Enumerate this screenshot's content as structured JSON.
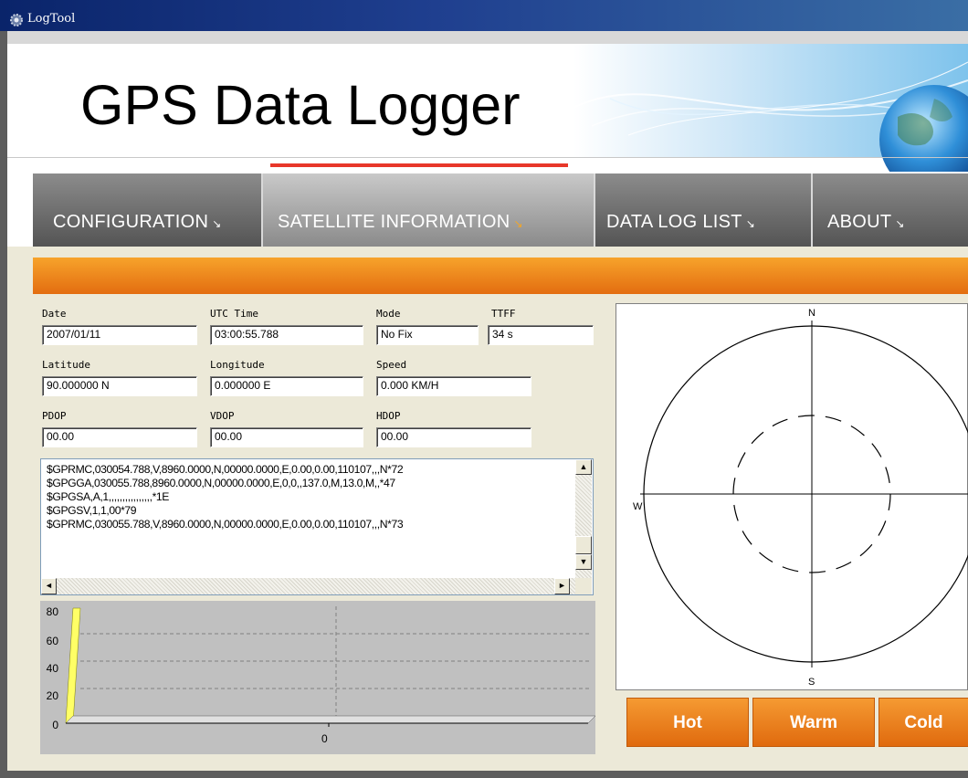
{
  "window": {
    "title": "LogTool"
  },
  "banner": {
    "title": "GPS Data Logger"
  },
  "tabs": [
    {
      "label": "CONFIGURATION",
      "arrow": "↘"
    },
    {
      "label": "SATELLITE  INFORMATION",
      "arrow": "↘"
    },
    {
      "label": "DATA LOG LIST",
      "arrow": "↘"
    },
    {
      "label": "ABOUT",
      "arrow": "↘"
    }
  ],
  "active_tab": "SATELLITE  INFORMATION",
  "fields": {
    "date": {
      "label": "Date",
      "value": "2007/01/11"
    },
    "utc_time": {
      "label": "UTC Time",
      "value": "03:00:55.788"
    },
    "mode": {
      "label": "Mode",
      "value": "No Fix"
    },
    "ttff": {
      "label": "TTFF",
      "value": "34 s"
    },
    "latitude": {
      "label": "Latitude",
      "value": "90.000000 N"
    },
    "longitude": {
      "label": "Longitude",
      "value": "0.000000 E"
    },
    "speed": {
      "label": "Speed",
      "value": "0.000 KM/H"
    },
    "pdop": {
      "label": "PDOP",
      "value": "00.00"
    },
    "vdop": {
      "label": "VDOP",
      "value": "00.00"
    },
    "hdop": {
      "label": "HDOP",
      "value": "00.00"
    }
  },
  "nmea": {
    "lines": [
      "$GPRMC,030054.788,V,8960.0000,N,00000.0000,E,0.00,0.00,110107,,,N*72",
      "$GPGGA,030055.788,8960.0000,N,00000.0000,E,0,0,,137.0,M,13.0,M,,*47",
      "$GPGSA,A,1,,,,,,,,,,,,,,,,*1E",
      "$GPGSV,1,1,00*79",
      "$GPRMC,030055.788,V,8960.0000,N,00000.0000,E,0.00,0.00,110107,,,N*73"
    ],
    "scroll_up": "▲",
    "scroll_down": "▼",
    "scroll_left": "◄",
    "scroll_right": "►"
  },
  "snr_chart": {
    "y_ticks": [
      "80",
      "60",
      "40",
      "20",
      "0"
    ],
    "x_ticks": [
      "0"
    ],
    "ylim": [
      0,
      80
    ],
    "bar_color": "#ffff66",
    "bars": []
  },
  "sky_view": {
    "north": "N",
    "south": "S",
    "west": "W"
  },
  "restart_buttons": [
    "Hot",
    "Warm",
    "Cold"
  ],
  "colors": {
    "accent_orange": "#e8741a",
    "tab_indicator": "#e8372a",
    "tab_dark": "#6b6b6b"
  }
}
